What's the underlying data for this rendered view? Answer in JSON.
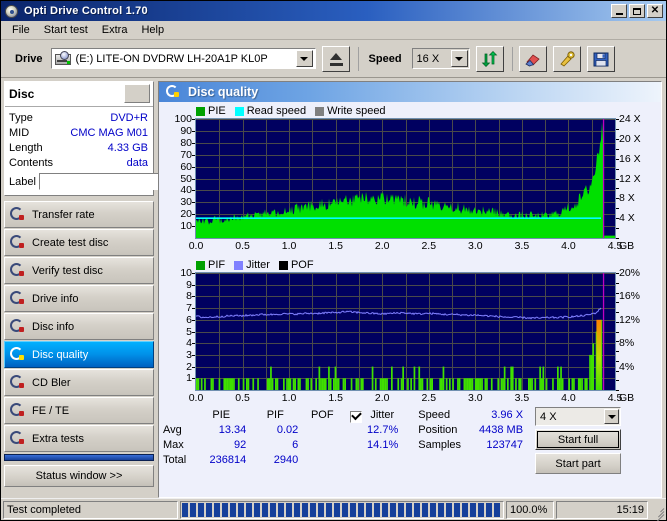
{
  "window": {
    "title": "Opti Drive Control 1.70",
    "icon": "disc-icon",
    "buttons": {
      "minimize": "_",
      "maximize": "□",
      "close": "×"
    }
  },
  "menu": {
    "items": [
      "File",
      "Start test",
      "Extra",
      "Help"
    ]
  },
  "toolbar": {
    "drive_label": "Drive",
    "drive_value": "(E:)  LITE-ON DVDRW LH-20A1P KL0P",
    "eject_icon": "eject-icon",
    "speed_label": "Speed",
    "speed_value": "16 X",
    "refresh_icon": "refresh-icon",
    "erase_icon": "erase-icon",
    "tools_icon": "tools-icon",
    "save_icon": "save-icon"
  },
  "disc_panel": {
    "heading": "Disc",
    "rows": [
      {
        "key": "Type",
        "value": "DVD+R"
      },
      {
        "key": "MID",
        "value": "CMC MAG M01"
      },
      {
        "key": "Length",
        "value": "4.33 GB"
      },
      {
        "key": "Contents",
        "value": "data"
      }
    ],
    "label_key": "Label",
    "label_value": "",
    "label_placeholder": "",
    "cd_button_icon": "disc-icon"
  },
  "nav": {
    "items": [
      {
        "label": "Transfer rate",
        "icon": "disc-transfer-icon",
        "active": false
      },
      {
        "label": "Create test disc",
        "icon": "disc-create-icon",
        "active": false
      },
      {
        "label": "Verify test disc",
        "icon": "disc-verify-icon",
        "active": false
      },
      {
        "label": "Drive info",
        "icon": "disc-drive-icon",
        "active": false
      },
      {
        "label": "Disc info",
        "icon": "disc-info-icon",
        "active": false
      },
      {
        "label": "Disc quality",
        "icon": "disc-quality-icon",
        "active": true
      },
      {
        "label": "CD Bler",
        "icon": "disc-bler-icon",
        "active": false
      },
      {
        "label": "FE / TE",
        "icon": "disc-fete-icon",
        "active": false
      },
      {
        "label": "Extra tests",
        "icon": "disc-extra-icon",
        "active": false
      }
    ],
    "status_window_label": "Status window >>"
  },
  "panel": {
    "title": "Disc quality",
    "icon": "disc-quality-icon"
  },
  "chart_data": [
    {
      "id": "pie-chart",
      "type": "area",
      "title": "",
      "xlabel": "GB",
      "ylabel": "",
      "xlim": [
        0,
        4.5
      ],
      "ylim": [
        0,
        100
      ],
      "y2lim": [
        0,
        24
      ],
      "y2label": "X",
      "grid": true,
      "legend_position": "top-left",
      "legend": [
        {
          "name": "PIE",
          "color": "#00a000"
        },
        {
          "name": "Read speed",
          "color": "#00ffff"
        },
        {
          "name": "Write speed",
          "color": "#808080"
        }
      ],
      "yticks": [
        10,
        20,
        30,
        40,
        50,
        60,
        70,
        80,
        90,
        100
      ],
      "xticks": [
        "0.0",
        "0.5",
        "1.0",
        "1.5",
        "2.0",
        "2.5",
        "3.0",
        "3.5",
        "4.0",
        "4.5"
      ],
      "y2ticks": [
        "4 X",
        "8 X",
        "12 X",
        "16 X",
        "20 X",
        "24 X"
      ],
      "x_unit": "GB",
      "series": [
        {
          "name": "PIE",
          "color": "#00e000",
          "kind": "bars",
          "x": [
            0.0,
            0.05,
            0.1,
            0.15,
            0.2,
            0.25,
            0.3,
            0.35,
            0.4,
            0.45,
            0.5,
            0.55,
            0.6,
            0.65,
            0.7,
            0.75,
            0.8,
            0.85,
            0.9,
            0.95,
            1.0,
            1.05,
            1.1,
            1.15,
            1.2,
            1.25,
            1.3,
            1.35,
            1.4,
            1.45,
            1.5,
            1.55,
            1.6,
            1.65,
            1.7,
            1.75,
            1.8,
            1.85,
            1.9,
            1.95,
            2.0,
            2.05,
            2.1,
            2.15,
            2.2,
            2.25,
            2.3,
            2.35,
            2.4,
            2.45,
            2.5,
            2.55,
            2.6,
            2.65,
            2.7,
            2.75,
            2.8,
            2.85,
            2.9,
            2.95,
            3.0,
            3.05,
            3.1,
            3.15,
            3.2,
            3.25,
            3.3,
            3.35,
            3.4,
            3.45,
            3.5,
            3.55,
            3.6,
            3.65,
            3.7,
            3.75,
            3.8,
            3.85,
            3.9,
            3.95,
            4.0,
            4.05,
            4.1,
            4.15,
            4.2,
            4.25,
            4.3,
            4.33,
            4.36,
            4.38
          ],
          "values": [
            14,
            13,
            14,
            13,
            15,
            14,
            14,
            15,
            16,
            15,
            17,
            18,
            17,
            19,
            18,
            20,
            21,
            20,
            22,
            21,
            23,
            22,
            24,
            23,
            25,
            26,
            25,
            27,
            26,
            28,
            29,
            28,
            30,
            29,
            31,
            30,
            32,
            31,
            33,
            30,
            32,
            31,
            30,
            31,
            29,
            30,
            29,
            28,
            29,
            27,
            28,
            27,
            26,
            25,
            26,
            24,
            25,
            23,
            24,
            22,
            23,
            21,
            22,
            20,
            21,
            19,
            20,
            18,
            19,
            17,
            18,
            17,
            18,
            17,
            18,
            17,
            18,
            19,
            20,
            22,
            24,
            26,
            29,
            33,
            38,
            45,
            58,
            75,
            92,
            80
          ]
        },
        {
          "name": "Read speed",
          "color": "#00ffff",
          "kind": "line",
          "axis": "y2",
          "x": [
            0.0,
            0.5,
            1.0,
            1.5,
            2.0,
            2.5,
            3.0,
            3.5,
            4.0,
            4.35
          ],
          "values": [
            4.0,
            4.0,
            4.0,
            4.0,
            4.0,
            4.0,
            4.0,
            4.0,
            4.0,
            4.0
          ]
        }
      ],
      "marker_line": {
        "x": 4.37,
        "color": "#c000c0"
      }
    },
    {
      "id": "pif-chart",
      "type": "bar",
      "title": "",
      "xlabel": "GB",
      "ylabel": "",
      "xlim": [
        0,
        4.5
      ],
      "ylim": [
        0,
        10
      ],
      "y2lim": [
        0,
        20
      ],
      "y2label": "%",
      "grid": true,
      "legend_position": "top-left",
      "legend": [
        {
          "name": "PIF",
          "color": "#00a000"
        },
        {
          "name": "Jitter",
          "color": "#8080ff"
        },
        {
          "name": "POF",
          "color": "#000000"
        }
      ],
      "yticks": [
        1,
        2,
        3,
        4,
        5,
        6,
        7,
        8,
        9,
        10
      ],
      "xticks": [
        "0.0",
        "0.5",
        "1.0",
        "1.5",
        "2.0",
        "2.5",
        "3.0",
        "3.5",
        "4.0",
        "4.5"
      ],
      "y2ticks": [
        "4%",
        "8%",
        "12%",
        "16%",
        "20%"
      ],
      "x_unit": "GB",
      "series": [
        {
          "name": "PIF",
          "color": "#40e000",
          "kind": "bars",
          "x": [
            0.02,
            0.05,
            0.09,
            0.12,
            0.15,
            0.19,
            0.22,
            0.26,
            0.3,
            0.34,
            0.38,
            0.42,
            0.46,
            0.52,
            0.56,
            0.6,
            0.64,
            0.7,
            0.74,
            0.78,
            0.84,
            0.88,
            0.92,
            0.97,
            1.02,
            1.06,
            1.1,
            1.14,
            1.18,
            1.23,
            1.28,
            1.33,
            1.38,
            1.43,
            1.48,
            1.52,
            1.57,
            1.62,
            1.66,
            1.71,
            1.76,
            1.8,
            1.85,
            1.9,
            1.95,
            2.0,
            2.05,
            2.1,
            2.16,
            2.21,
            2.26,
            2.31,
            2.36,
            2.41,
            2.46,
            2.52,
            2.57,
            2.62,
            2.68,
            2.73,
            2.78,
            2.84,
            2.9,
            2.96,
            3.02,
            3.08,
            3.14,
            3.2,
            3.26,
            3.32,
            3.38,
            3.44,
            3.5,
            3.56,
            3.62,
            3.68,
            3.74,
            3.8,
            3.86,
            3.92,
            3.98,
            4.04,
            4.1,
            4.16,
            4.21,
            4.26,
            4.3,
            4.33,
            4.35
          ],
          "values": [
            1,
            1,
            1,
            1,
            2,
            1,
            1,
            1,
            1,
            1,
            1,
            1,
            1,
            1,
            1,
            1,
            1,
            1,
            1,
            1,
            2,
            1,
            1,
            1,
            1,
            1,
            2,
            1,
            1,
            1,
            1,
            1,
            2,
            1,
            1,
            1,
            1,
            2,
            1,
            1,
            1,
            1,
            1,
            1,
            1,
            1,
            1,
            1,
            1,
            1,
            1,
            1,
            1,
            1,
            1,
            1,
            1,
            1,
            1,
            1,
            1,
            1,
            2,
            1,
            2,
            1,
            1,
            1,
            1,
            1,
            2,
            1,
            1,
            1,
            1,
            1,
            1,
            1,
            1,
            1,
            1,
            1,
            1,
            1,
            2,
            3,
            6,
            6,
            3
          ]
        },
        {
          "name": "Jitter",
          "color": "#8080ff",
          "kind": "line",
          "axis": "y2",
          "x": [
            0.0,
            0.1,
            0.2,
            0.3,
            0.4,
            0.5,
            0.6,
            0.7,
            0.8,
            0.9,
            1.0,
            1.1,
            1.2,
            1.3,
            1.4,
            1.5,
            1.6,
            1.7,
            1.8,
            1.9,
            2.0,
            2.1,
            2.2,
            2.3,
            2.4,
            2.5,
            2.6,
            2.7,
            2.8,
            2.9,
            3.0,
            3.1,
            3.2,
            3.3,
            3.4,
            3.5,
            3.6,
            3.7,
            3.8,
            3.9,
            4.0,
            4.1,
            4.2,
            4.3,
            4.35
          ],
          "values": [
            12.6,
            12.4,
            12.5,
            12.6,
            12.7,
            12.7,
            12.8,
            12.9,
            12.9,
            13.0,
            13.0,
            13.0,
            13.1,
            13.1,
            13.2,
            13.2,
            13.4,
            13.3,
            13.2,
            13.1,
            13.0,
            13.1,
            13.2,
            13.1,
            13.0,
            13.1,
            13.0,
            12.9,
            12.9,
            12.8,
            12.8,
            12.7,
            12.6,
            12.5,
            12.4,
            12.4,
            12.3,
            12.3,
            12.4,
            12.4,
            12.5,
            12.6,
            12.8,
            13.2,
            14.1
          ]
        },
        {
          "name": "POF",
          "color": "#000000",
          "kind": "bars",
          "x": [],
          "values": []
        }
      ],
      "marker_line": {
        "x": 4.37,
        "color": "#c000c0"
      }
    }
  ],
  "stats": {
    "columns": [
      "",
      "PIE",
      "PIF",
      "POF",
      "Jitter"
    ],
    "jitter_checked": true,
    "rows": [
      {
        "label": "Avg",
        "pie": "13.34",
        "pif": "0.02",
        "pof": "",
        "jitter": "12.7%"
      },
      {
        "label": "Max",
        "pie": "92",
        "pif": "6",
        "pof": "",
        "jitter": "14.1%"
      },
      {
        "label": "Total",
        "pie": "236814",
        "pif": "2940",
        "pof": "",
        "jitter": ""
      }
    ],
    "info": [
      {
        "key": "Speed",
        "value": "3.96 X"
      },
      {
        "key": "Position",
        "value": "4438 MB"
      },
      {
        "key": "Samples",
        "value": "123747"
      }
    ],
    "test_speed_value": "4 X",
    "start_full_label": "Start full",
    "start_part_label": "Start part"
  },
  "statusbar": {
    "message": "Test completed",
    "progress_percent": "100.0%",
    "progress_value": 100,
    "time": "15:19"
  }
}
